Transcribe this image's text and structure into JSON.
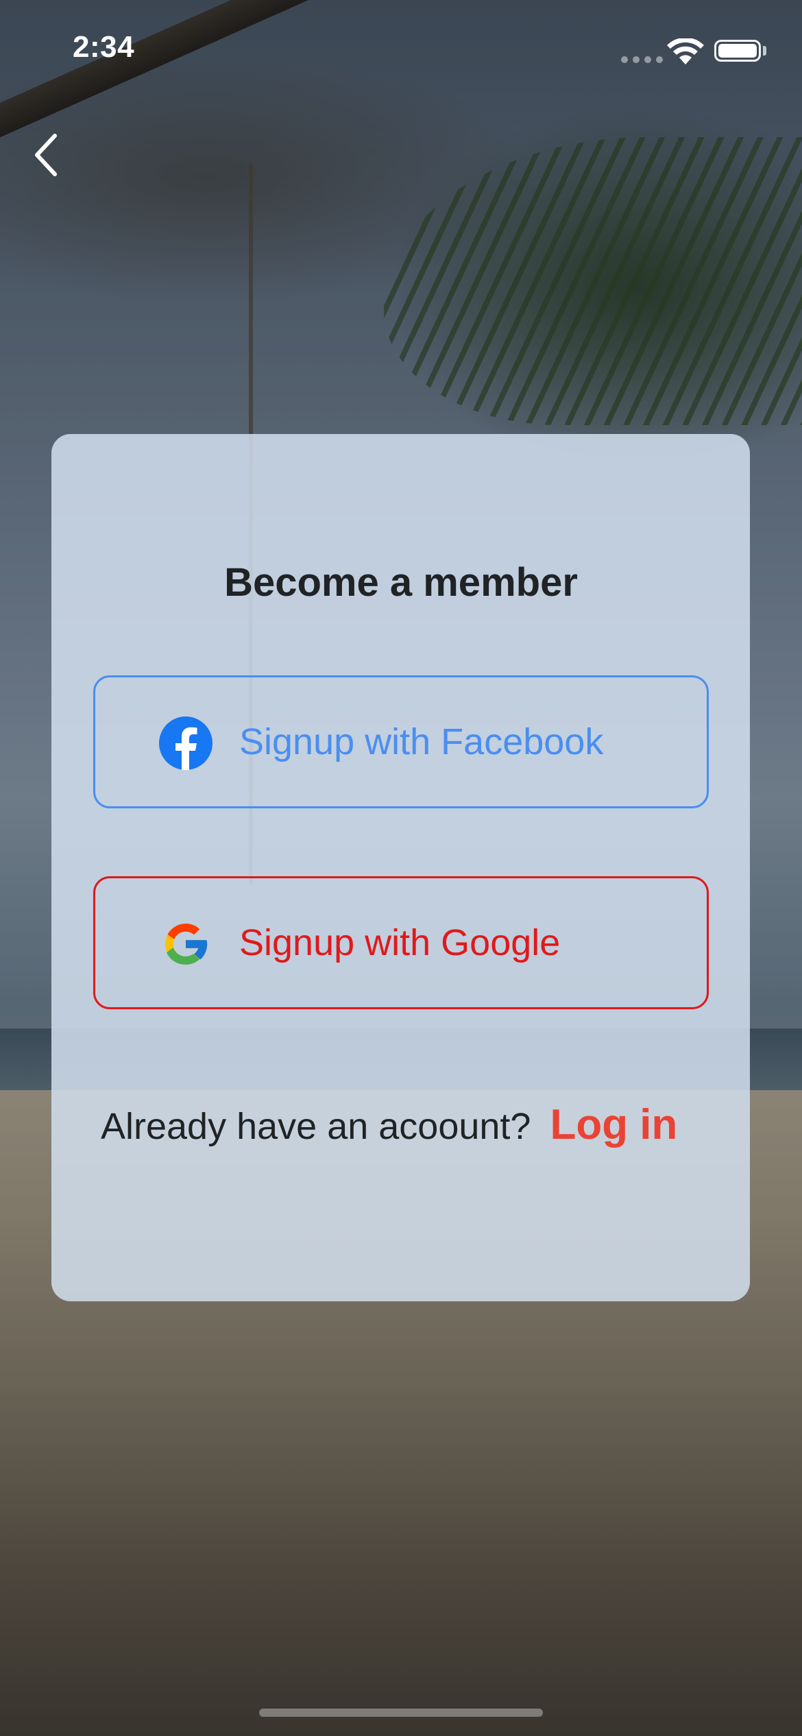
{
  "status_bar": {
    "time": "2:34"
  },
  "navigation": {
    "back_icon": "chevron-left-icon"
  },
  "card": {
    "title": "Become a member",
    "facebook_button": {
      "label": "Signup with Facebook",
      "icon": "facebook-icon",
      "color": "#4a8ef0"
    },
    "google_button": {
      "label": "Signup with Google",
      "icon": "google-icon",
      "color": "#e0191b"
    },
    "login_prompt": "Already have an acoount?",
    "login_link": "Log in",
    "login_link_color": "#ea4335"
  }
}
